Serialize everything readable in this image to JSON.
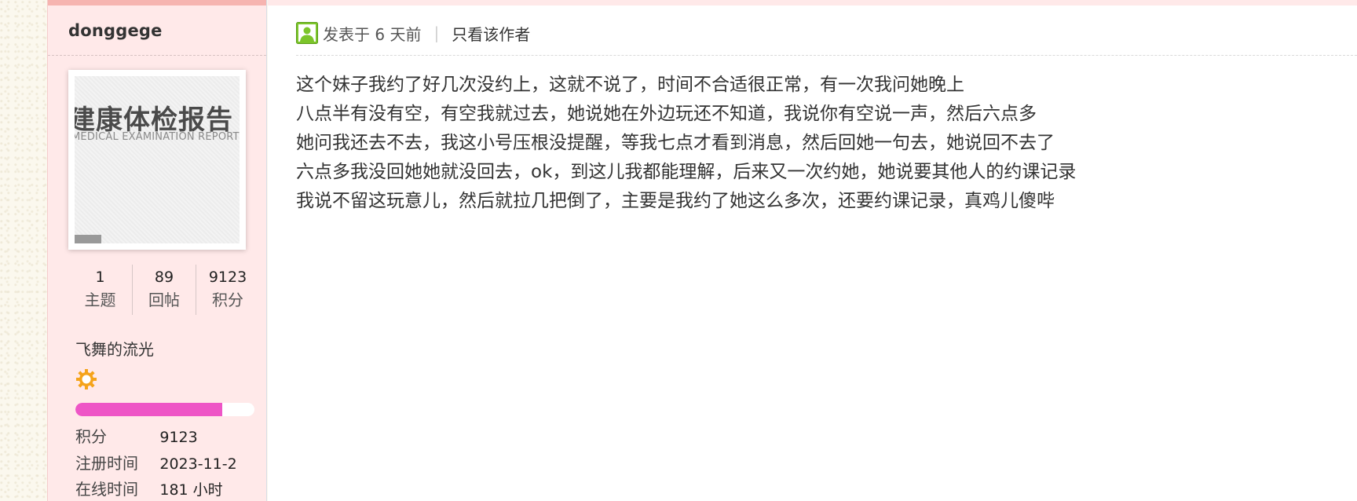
{
  "author": {
    "username": "donggege",
    "avatar": {
      "title": "建康体检报告",
      "subtitle": "MEDICAL EXAMINATION REPORT"
    },
    "stats": [
      {
        "value": "1",
        "label": "主题"
      },
      {
        "value": "89",
        "label": "回帖"
      },
      {
        "value": "9123",
        "label": "积分"
      }
    ],
    "group": "飞舞的流光",
    "rank_icon": "sun-icon",
    "level_progress": 0.82,
    "info": {
      "points_label": "积分",
      "points_value": "9123",
      "register_label": "注册时间",
      "register_value": "2023-11-2",
      "online_label": "在线时间",
      "online_value": "181 小时"
    }
  },
  "post": {
    "status_icon": "user-online-icon",
    "posted": "发表于 6 天前",
    "separator": "|",
    "only_author": "只看该作者",
    "lines": [
      "这个妹子我约了好几次没约上，这就不说了，时间不合适很正常，有一次我问她晚上",
      "八点半有没有空，有空我就过去，她说她在外边玩还不知道，我说你有空说一声，然后六点多",
      "她问我还去不去，我这小号压根没提醒，等我七点才看到消息，然后回她一句去，她说回不去了",
      "六点多我没回她她就没回去，ok，到这儿我都能理解，后来又一次约她，她说要其他人的约课记录",
      "我说不留这玩意儿，然后就拉几把倒了，主要是我约了她这么多次，还要约课记录，真鸡儿傻哔"
    ]
  },
  "colors": {
    "sidebar_bg": "#ffe9e9",
    "level_bar": "#ee55c6",
    "rank_icon": "#f5a31a",
    "online_icon": "#7cc52a"
  }
}
